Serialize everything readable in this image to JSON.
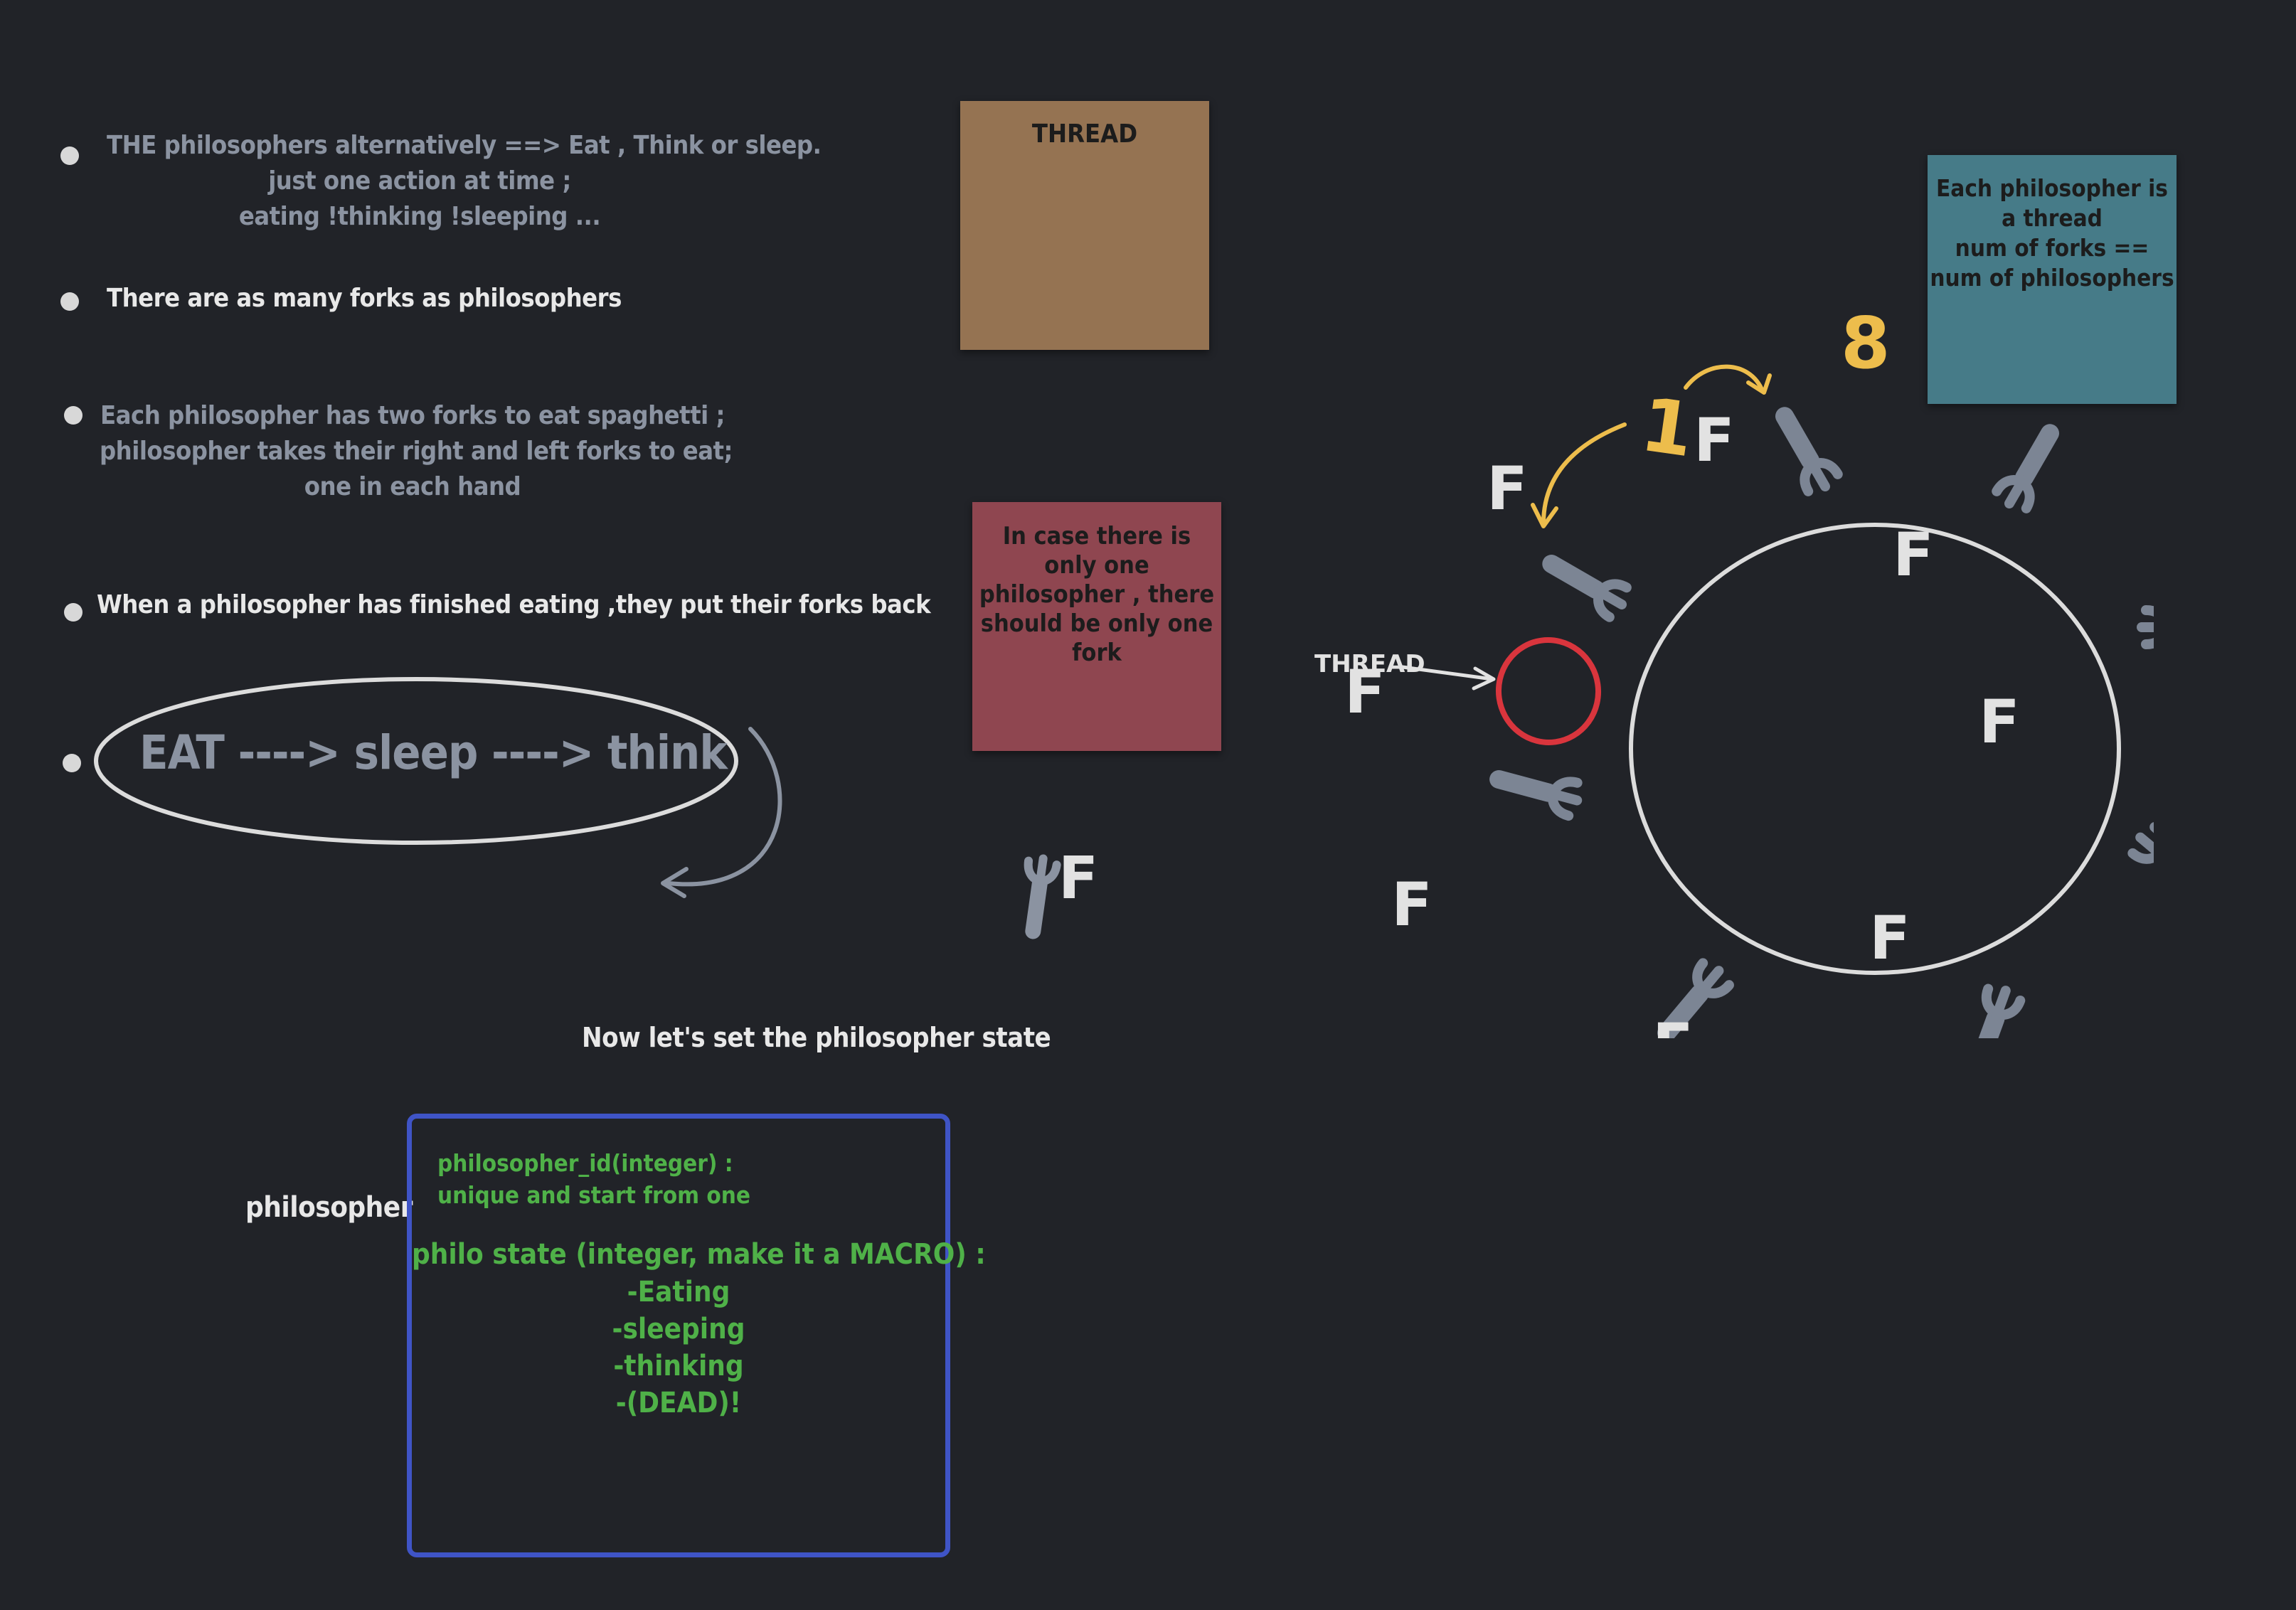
{
  "notes": {
    "note1": [
      "THE philosophers alternatively ==> Eat , Think or sleep.",
      "just one action at time ;",
      "eating !thinking !sleeping ..."
    ],
    "note2": "There are as many forks as philosophers",
    "note3": [
      "Each philosopher has two forks to eat spaghetti ;",
      "philosopher takes their right and left forks to eat;",
      "one in each hand"
    ],
    "note4": "When a philosopher has finished eating ,they put their forks back",
    "flow": "EAT ----> sleep ----> think"
  },
  "stickies": {
    "thread": "THREAD",
    "one_philosopher": [
      "In case there is",
      "only one",
      "philosopher , there",
      "should be only one",
      "fork"
    ],
    "each_philosopher": [
      "Each philosopher is",
      "a thread",
      "num of forks ==",
      "num of philosophers"
    ]
  },
  "diagram": {
    "thread_label": "THREAD",
    "fork_letter": "F",
    "count_one": "1",
    "count_eight": "8",
    "fork_count": 8
  },
  "legend_fork": "F",
  "state_heading": "Now let's set the philosopher state",
  "struct": {
    "label": "philosopher",
    "id_lines": [
      "philosopher_id(integer) :",
      "unique and start from one"
    ],
    "state_lines": [
      "philo state (integer, make it a MACRO) :",
      "-Eating",
      "-sleeping",
      "-thinking",
      "-(DEAD)!"
    ]
  },
  "colors": {
    "background": "#212328",
    "sticky_brown": "#957352",
    "sticky_red": "#8f4650",
    "sticky_teal": "#467b88",
    "accent_yellow": "#edbd4c",
    "highlight_red": "#d9353d",
    "code_green": "#4fb148",
    "box_blue": "#3f54c6"
  }
}
